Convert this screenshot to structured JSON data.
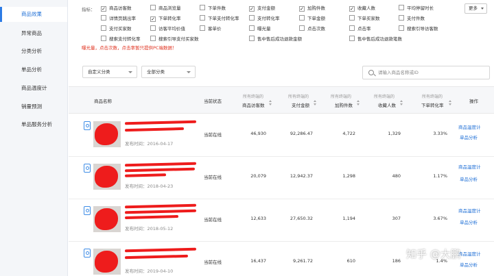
{
  "sidebar": {
    "items": [
      {
        "label": "商品效果",
        "active": true
      },
      {
        "label": "异常商品",
        "active": false
      },
      {
        "label": "分类分析",
        "active": false
      },
      {
        "label": "单品分析",
        "active": false
      },
      {
        "label": "商品温度计",
        "active": false
      },
      {
        "label": "销量预测",
        "active": false
      },
      {
        "label": "单品服务分析",
        "active": false
      }
    ]
  },
  "filters": {
    "label": "指标：",
    "more_label": "更多",
    "options": [
      {
        "label": "商品访客数",
        "checked": true
      },
      {
        "label": "商品浏览量",
        "checked": false
      },
      {
        "label": "下单件数",
        "checked": false
      },
      {
        "label": "支付金额",
        "checked": true
      },
      {
        "label": "加购件数",
        "checked": true
      },
      {
        "label": "收藏人数",
        "checked": true
      },
      {
        "label": "平均停留时长",
        "checked": false
      },
      {
        "label": "详情页跳出率",
        "checked": false
      },
      {
        "label": "下单转化率",
        "checked": true
      },
      {
        "label": "下单支付转化率",
        "checked": false
      },
      {
        "label": "支付转化率",
        "checked": false
      },
      {
        "label": "下单金额",
        "checked": false
      },
      {
        "label": "下单买家数",
        "checked": false
      },
      {
        "label": "支付件数",
        "checked": false
      },
      {
        "label": "支付买家数",
        "checked": false
      },
      {
        "label": "访客平均价值",
        "checked": false
      },
      {
        "label": "客单价",
        "checked": false
      },
      {
        "label": "曝光量",
        "checked": false
      },
      {
        "label": "点击次数",
        "checked": false
      },
      {
        "label": "点击率",
        "checked": false
      },
      {
        "label": "搜索引导访客数",
        "checked": false
      },
      {
        "label": "搜索支付转化率",
        "checked": false
      },
      {
        "label": "搜索引导支付买家数",
        "checked": false
      },
      {
        "label": "售中售后成功退款金额",
        "checked": false
      },
      {
        "label": "售中售后成功退款笔数",
        "checked": false
      }
    ],
    "warning": "曝光量，点击次数，点击率暂只提供PC端数据！"
  },
  "controls": {
    "custom_category": "自定义分类",
    "all_category": "全部分类",
    "search_placeholder": "请输入商品名称或ID"
  },
  "table": {
    "headers": {
      "product": "商品名称",
      "status": "当前状态",
      "visitors_sub": "所有终端的",
      "visitors": "商品访客数",
      "amount_sub": "所有终端的",
      "amount": "支付金额",
      "cart_sub": "所有终端的",
      "cart": "加购件数",
      "fav_sub": "所有终端的",
      "fav": "收藏人数",
      "conv_sub": "所有终端的",
      "conv": "下单转化率",
      "action": "操作"
    },
    "rows": [
      {
        "date": "发布时间：2016-04-17",
        "status": "当前在线",
        "visitors": "46,930",
        "amount": "92,286.47",
        "cart": "4,722",
        "fav": "1,329",
        "conv": "3.33%",
        "action1": "商品温度计",
        "action2": "单品分析"
      },
      {
        "date": "发布时间：2018-04-23",
        "status": "当前在线",
        "visitors": "20,079",
        "amount": "12,942.37",
        "cart": "1,298",
        "fav": "480",
        "conv": "1.17%",
        "action1": "商品温度计",
        "action2": "单品分析"
      },
      {
        "date": "发布时间：2018-05-12",
        "status": "当前在线",
        "visitors": "12,633",
        "amount": "27,650.32",
        "cart": "1,194",
        "fav": "307",
        "conv": "3.67%",
        "action1": "商品温度计",
        "action2": "单品分析"
      },
      {
        "date": "发布时间：2019-04-10",
        "status": "当前在线",
        "visitors": "16,437",
        "amount": "9,261.72",
        "cart": "610",
        "fav": "186",
        "conv": "1.4%",
        "action1": "商品温度计",
        "action2": "单品分析"
      }
    ]
  },
  "watermark": "知乎 @大鹏"
}
